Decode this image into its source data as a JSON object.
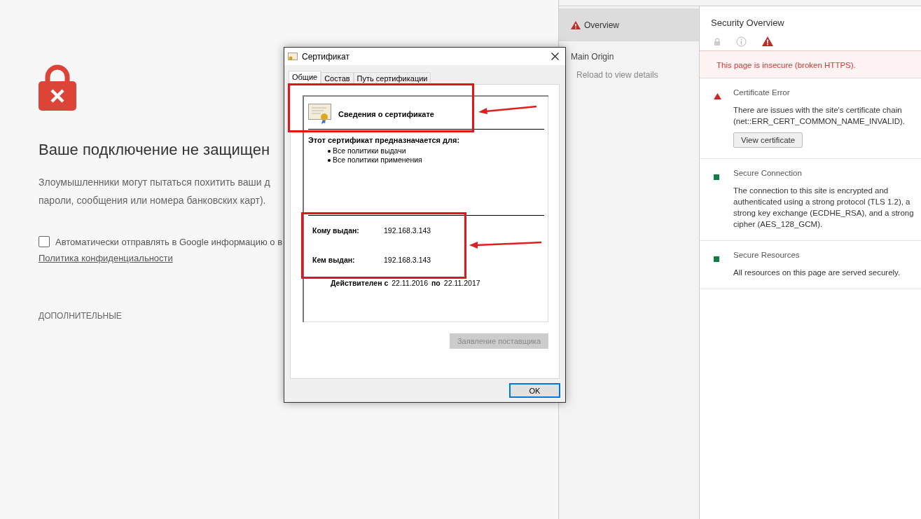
{
  "page": {
    "title": "Ваше подключение не защищен",
    "body_lines": [
      "Злоумышленники могут пытаться похитить ваши д",
      "пароли, сообщения или номера банковских карт)."
    ],
    "report_checkbox": {
      "label": "Автоматически отправлять в Google информацию о в",
      "checked": false
    },
    "privacy_link": "Политика конфиденциальности",
    "advanced": "ДОПОЛНИТЕЛЬНЫЕ"
  },
  "dialog": {
    "title": "Сертификат",
    "tabs": [
      {
        "label": "Общие",
        "selected": true
      },
      {
        "label": "Состав",
        "selected": false
      },
      {
        "label": "Путь сертификации",
        "selected": false
      }
    ],
    "heading": "Сведения о сертификате",
    "purpose_title": "Этот сертификат предназначается для:",
    "purposes": [
      "Все политики выдачи",
      "Все политики применения"
    ],
    "fields": [
      {
        "label": "Кому выдан:",
        "value": "192.168.3.143"
      },
      {
        "label": "Кем выдан:",
        "value": "192.168.3.143"
      }
    ],
    "validity": {
      "from_label": "Действителен с",
      "from": "22.11.2016",
      "to_label": "по",
      "to": "22.11.2017"
    },
    "statement_button": {
      "label": "Заявление поставщика",
      "disabled": true
    },
    "ok_button": {
      "label": "OK"
    }
  },
  "devtools": {
    "sidebar": {
      "items": [
        {
          "label": "Overview",
          "selected": true
        }
      ],
      "origin_title": "Main Origin",
      "origin_hint": "Reload to view details"
    },
    "main": {
      "title": "Security Overview",
      "summary_icons": [
        {
          "kind": "lock",
          "selected": false
        },
        {
          "kind": "info",
          "selected": false
        },
        {
          "kind": "warning",
          "selected": true
        }
      ],
      "banner": "This page is insecure (broken HTTPS).",
      "sections": [
        {
          "kind": "error",
          "title": "Certificate Error",
          "text": "There are issues with the site's certificate chain (net::ERR_CERT_COMMON_NAME_INVALID).",
          "button": "View certificate"
        },
        {
          "kind": "secure",
          "title": "Secure Connection",
          "text": "The connection to this site is encrypted and authenticated using a strong protocol (TLS 1.2), a strong key exchange (ECDHE_RSA), and a strong cipher (AES_128_GCM)."
        },
        {
          "kind": "secure",
          "title": "Secure Resources",
          "text": "All resources on this page are served securely."
        }
      ]
    }
  }
}
